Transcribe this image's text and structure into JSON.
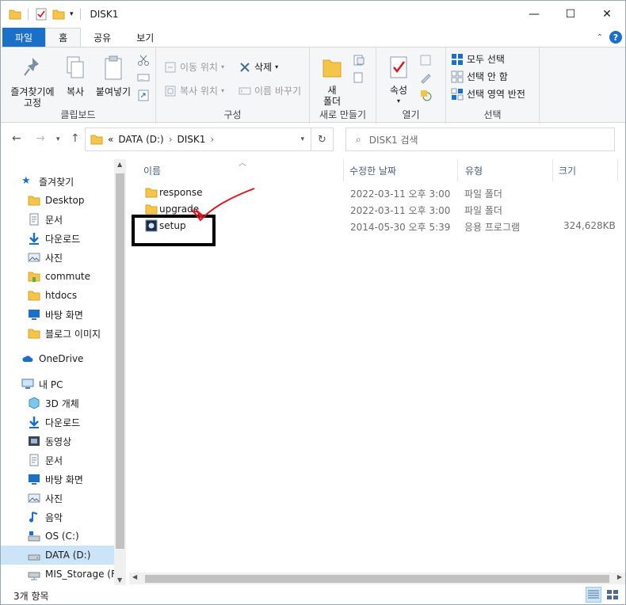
{
  "window": {
    "title": "DISK1",
    "controls": {
      "minimize": "—",
      "maximize": "☐",
      "close": "✕"
    }
  },
  "ribbon": {
    "tabs": [
      {
        "label": "파일",
        "kind": "file"
      },
      {
        "label": "홈",
        "kind": "active"
      },
      {
        "label": "공유",
        "kind": "normal"
      },
      {
        "label": "보기",
        "kind": "normal"
      }
    ],
    "help": "?",
    "groups": {
      "clipboard": {
        "label": "클립보드",
        "pin_line1": "즐겨찾기에",
        "pin_line2": "고정",
        "copy": "복사",
        "paste": "붙여넣기"
      },
      "organize": {
        "label": "구성",
        "move_to": "이동 위치",
        "copy_to": "복사 위치",
        "delete": "삭제",
        "rename": "이름 바꾸기"
      },
      "new": {
        "label": "새로 만들기",
        "new_folder_line1": "새",
        "new_folder_line2": "폴더"
      },
      "open": {
        "label": "열기",
        "properties": "속성"
      },
      "select": {
        "label": "선택",
        "select_all": "모두 선택",
        "select_none": "선택 안 함",
        "invert": "선택 영역 반전"
      }
    }
  },
  "address": {
    "prefix": "«",
    "crumbs": [
      "DATA (D:)",
      "DISK1"
    ],
    "search_placeholder": "DISK1 검색"
  },
  "nav": {
    "quick_access": "즐겨찾기",
    "items": [
      {
        "label": "Desktop",
        "icon": "desktop-folder-icon",
        "pinned": true
      },
      {
        "label": "문서",
        "icon": "documents-icon",
        "pinned": true
      },
      {
        "label": "다운로드",
        "icon": "download-icon",
        "pinned": true
      },
      {
        "label": "사진",
        "icon": "pictures-icon",
        "pinned": true
      },
      {
        "label": "commute",
        "icon": "folder-green-icon",
        "pinned": false
      },
      {
        "label": "htdocs",
        "icon": "folder-icon",
        "pinned": false
      },
      {
        "label": "바탕 화면",
        "icon": "desktop-icon",
        "pinned": false
      },
      {
        "label": "블로그 이미지",
        "icon": "folder-icon",
        "pinned": false
      }
    ],
    "onedrive": "OneDrive",
    "this_pc": "내 PC",
    "pc_items": [
      {
        "label": "3D 개체",
        "icon": "3d-objects-icon"
      },
      {
        "label": "다운로드",
        "icon": "download-icon"
      },
      {
        "label": "동영상",
        "icon": "videos-icon"
      },
      {
        "label": "문서",
        "icon": "documents-icon"
      },
      {
        "label": "바탕 화면",
        "icon": "desktop-icon"
      },
      {
        "label": "사진",
        "icon": "pictures-icon"
      },
      {
        "label": "음악",
        "icon": "music-icon"
      },
      {
        "label": "OS (C:)",
        "icon": "drive-c-icon"
      },
      {
        "label": "DATA (D:)",
        "icon": "drive-d-icon",
        "selected": true
      },
      {
        "label": "MIS_Storage (F:)",
        "icon": "network-drive-icon"
      }
    ]
  },
  "files": {
    "columns": {
      "name": "이름",
      "modified": "수정한 날짜",
      "type": "유형",
      "size": "크기"
    },
    "rows": [
      {
        "name": "response",
        "modified": "2022-03-11 오후 3:00",
        "type": "파일 폴더",
        "size": "",
        "icon": "folder-icon"
      },
      {
        "name": "upgrade",
        "modified": "2022-03-11 오후 3:00",
        "type": "파일 폴더",
        "size": "",
        "icon": "folder-icon"
      },
      {
        "name": "setup",
        "modified": "2014-05-30 오후 5:39",
        "type": "응용 프로그램",
        "size": "324,628KB",
        "icon": "application-icon"
      }
    ]
  },
  "status": {
    "count": "3개 항목"
  },
  "colors": {
    "accent": "#1a6fc9",
    "selection": "#cce4f7",
    "folder": "#f4c54a",
    "annotation": "#e0141e"
  }
}
